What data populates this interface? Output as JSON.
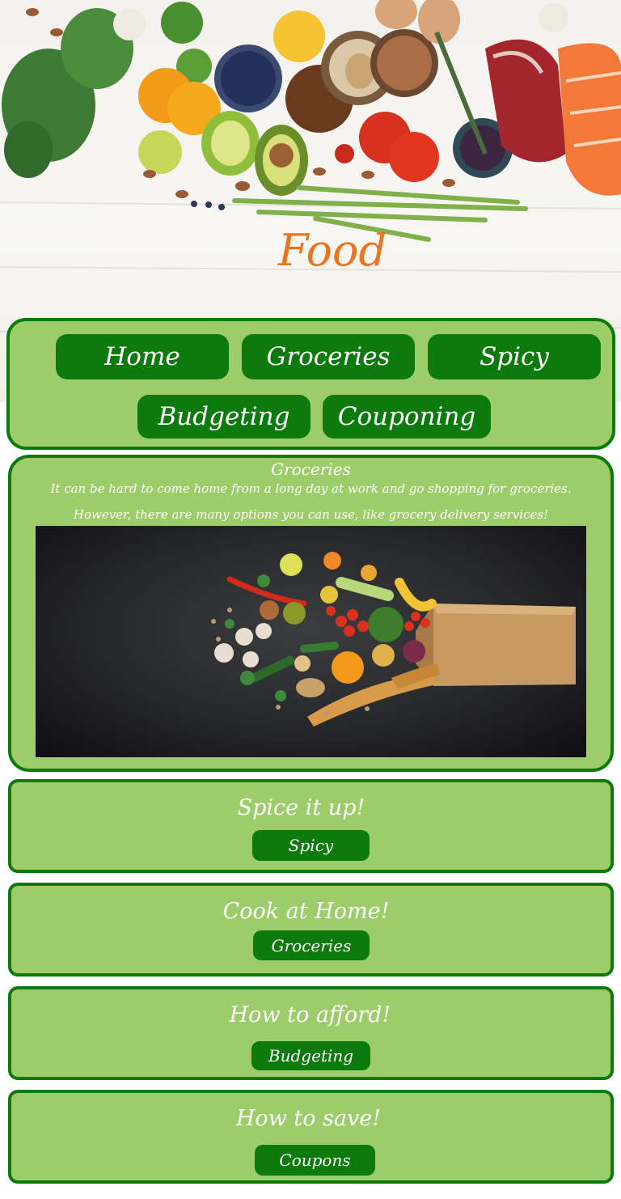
{
  "hero": {
    "title": "Food",
    "image_label": "fresh-produce-photo"
  },
  "nav": {
    "items": [
      {
        "label": "Home"
      },
      {
        "label": "Groceries"
      },
      {
        "label": "Spicy"
      },
      {
        "label": "Budgeting"
      },
      {
        "label": "Couponing"
      }
    ]
  },
  "feature": {
    "title": "Groceries",
    "line1": "It can be hard to come home from a long day at work and go shopping for groceries.",
    "line2": "However, there are many options you can use, like grocery delivery services!"
  },
  "cards": [
    {
      "title": "Spice it up!",
      "button": "Spicy"
    },
    {
      "title": "Cook at Home!",
      "button": "Groceries"
    },
    {
      "title": "How to afford!",
      "button": "Budgeting"
    },
    {
      "title": "How to save!",
      "button": "Coupons"
    }
  ],
  "colors": {
    "panel_bg": "#9dcd6a",
    "panel_border": "#0c7a0c",
    "button_bg": "#0c7a0c",
    "title_orange": "#e7761e"
  }
}
